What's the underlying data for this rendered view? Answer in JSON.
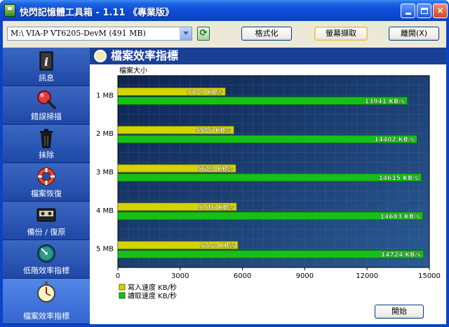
{
  "window": {
    "title": "快閃記憶體工具箱 - 1.11 《專業版》",
    "min_label": "",
    "max_label": "",
    "close_label": "×"
  },
  "toolbar": {
    "drive_value": "M:\\ VIA-P   VT6205-DevM (491 MB)",
    "refresh_label": "⟳",
    "format_label": "格式化",
    "capture_label": "螢幕擷取",
    "exit_label": "離開(X)"
  },
  "sidebar": {
    "items": [
      {
        "label": "訊息",
        "icon": "info-book-icon"
      },
      {
        "label": "錯誤掃描",
        "icon": "magnifier-icon"
      },
      {
        "label": "抹除",
        "icon": "trash-can-icon"
      },
      {
        "label": "檔案恢復",
        "icon": "life-ring-icon"
      },
      {
        "label": "備份 / 復原",
        "icon": "cassette-icon"
      },
      {
        "label": "低階效率指標",
        "icon": "gauge-icon"
      },
      {
        "label": "檔案效率指標",
        "icon": "stopwatch-icon"
      }
    ],
    "active_index": 6
  },
  "panel": {
    "title": "檔案效率指標",
    "start_label": "開始"
  },
  "colors": {
    "write": "#d4d400",
    "read": "#16c016",
    "plot_bg": "#122a5a",
    "accent": "#1a3f97"
  },
  "chart_data": {
    "type": "bar",
    "orientation": "horizontal",
    "ylabel": "檔案大小",
    "categories": [
      "1 MB",
      "2 MB",
      "3 MB",
      "4 MB",
      "5 MB"
    ],
    "series": [
      {
        "name": "寫入速度 KB/秒",
        "values": [
          5179,
          5586,
          5683,
          5716,
          5778
        ],
        "labels": [
          "5179 KB/s",
          "5586 KB/s",
          "5683 KB/s",
          "5716 KB/s",
          "5778 KB/s"
        ]
      },
      {
        "name": "讀取速度 KB/秒",
        "values": [
          13941,
          14402,
          14615,
          14683,
          14724
        ],
        "labels": [
          "13941 KB/s",
          "14402 KB/s",
          "14615 KB/s",
          "14683 KB/s",
          "14724 KB/s"
        ]
      }
    ],
    "xlim": [
      0,
      15000
    ],
    "xticks": [
      "0",
      "3000",
      "6000",
      "9000",
      "12000",
      "15000"
    ],
    "grid": true,
    "legend": "bottom-left"
  }
}
